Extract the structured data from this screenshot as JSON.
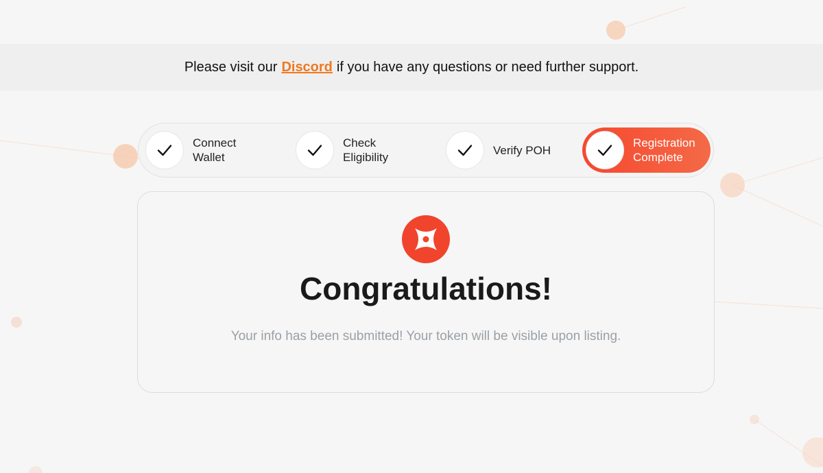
{
  "banner": {
    "prefix": "Please visit our",
    "link_label": "Discord",
    "suffix": "if you have any questions or need further support."
  },
  "steps": [
    {
      "label": "Connect\nWallet",
      "status": "complete"
    },
    {
      "label": "Check\nEligibility",
      "status": "complete"
    },
    {
      "label": "Verify POH",
      "status": "complete"
    },
    {
      "label": "Registration\nComplete",
      "status": "active"
    }
  ],
  "result": {
    "title": "Congratulations!",
    "message": "Your info has been submitted! Your token will be visible upon listing.",
    "icon": "brand-logo-icon"
  },
  "colors": {
    "accent": "#f1442c",
    "link": "#f0781e",
    "background": "#f6f6f6"
  }
}
